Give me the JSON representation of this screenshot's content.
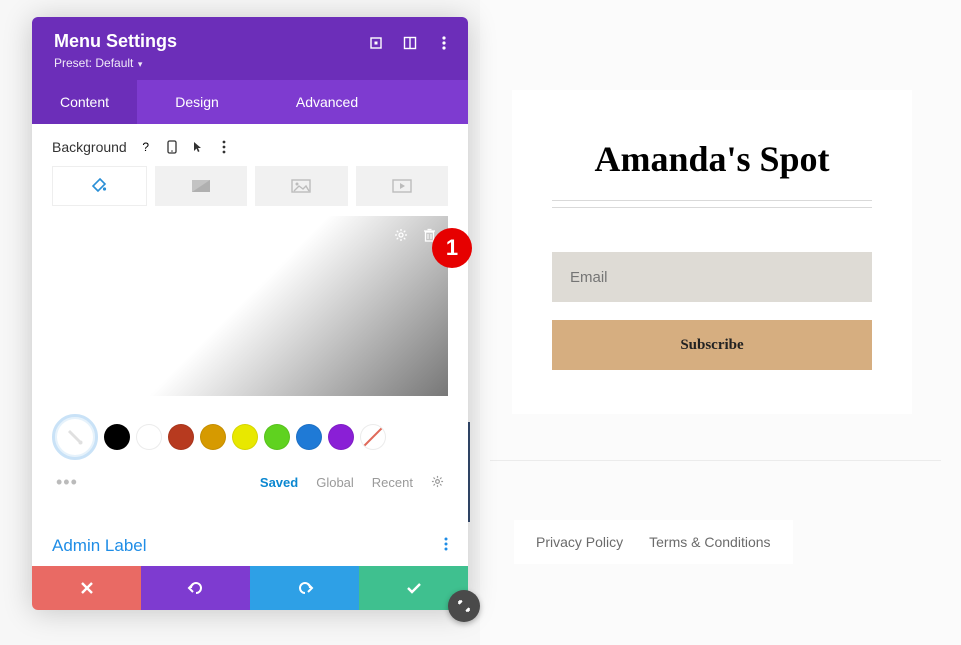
{
  "panel": {
    "title": "Menu Settings",
    "preset_label": "Preset: Default",
    "tabs": {
      "content": "Content",
      "design": "Design",
      "advanced": "Advanced"
    },
    "section_label": "Background",
    "swatches": [
      {
        "color": "#ffffff",
        "active": true
      },
      {
        "color": "#000000"
      },
      {
        "color": "#ffffff"
      },
      {
        "color": "#b73a1f"
      },
      {
        "color": "#d69a00"
      },
      {
        "color": "#e8e800"
      },
      {
        "color": "#5fd21f"
      },
      {
        "color": "#1f7ad6"
      },
      {
        "color": "#8a1fd6"
      },
      {
        "color": "none"
      }
    ],
    "palette_tabs": {
      "saved": "Saved",
      "global": "Global",
      "recent": "Recent"
    },
    "admin_label": "Admin Label"
  },
  "annotation": {
    "number": "1"
  },
  "preview": {
    "site_title": "Amanda's Spot",
    "email_placeholder": "Email",
    "subscribe_label": "Subscribe",
    "footer_privacy": "Privacy Policy",
    "footer_terms": "Terms & Conditions"
  }
}
